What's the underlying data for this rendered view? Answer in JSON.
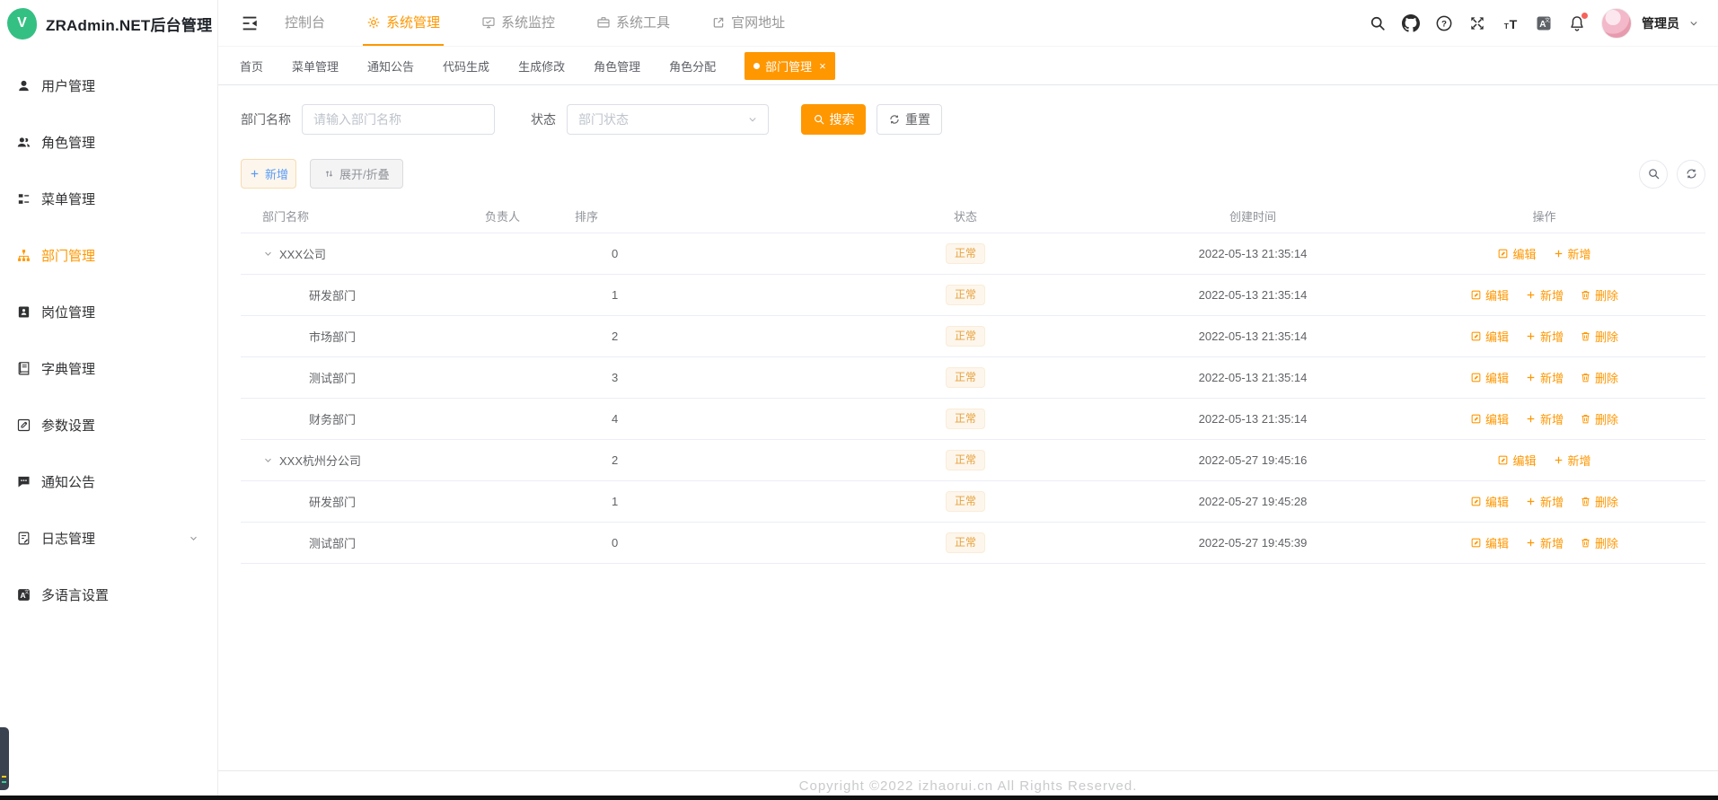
{
  "app": {
    "title": "ZRAdmin.NET后台管理",
    "logo_letter": "V",
    "accent_color": "#ff9700"
  },
  "sidebar": {
    "items": [
      {
        "label": "用户管理",
        "icon": "user-icon",
        "active": false
      },
      {
        "label": "角色管理",
        "icon": "users-icon",
        "active": false
      },
      {
        "label": "菜单管理",
        "icon": "menu-tree-icon",
        "active": false
      },
      {
        "label": "部门管理",
        "icon": "org-tree-icon",
        "active": true
      },
      {
        "label": "岗位管理",
        "icon": "id-badge-icon",
        "active": false
      },
      {
        "label": "字典管理",
        "icon": "dictionary-icon",
        "active": false
      },
      {
        "label": "参数设置",
        "icon": "pen-square-icon",
        "active": false
      },
      {
        "label": "通知公告",
        "icon": "comment-icon",
        "active": false
      },
      {
        "label": "日志管理",
        "icon": "log-icon",
        "active": false,
        "expandable": true
      },
      {
        "label": "多语言设置",
        "icon": "language-icon",
        "active": false
      }
    ]
  },
  "topnav": {
    "items": [
      {
        "label": "控制台",
        "icon": null,
        "active": false
      },
      {
        "label": "系统管理",
        "icon": "gear-icon",
        "active": true
      },
      {
        "label": "系统监控",
        "icon": "monitor-icon",
        "active": false
      },
      {
        "label": "系统工具",
        "icon": "toolbox-icon",
        "active": false
      },
      {
        "label": "官网地址",
        "icon": "external-link-icon",
        "active": false
      }
    ],
    "user": {
      "name": "管理员"
    }
  },
  "tabs": {
    "items": [
      {
        "label": "首页",
        "active": false
      },
      {
        "label": "菜单管理",
        "active": false
      },
      {
        "label": "通知公告",
        "active": false
      },
      {
        "label": "代码生成",
        "active": false
      },
      {
        "label": "生成修改",
        "active": false
      },
      {
        "label": "角色管理",
        "active": false
      },
      {
        "label": "角色分配",
        "active": false
      },
      {
        "label": "部门管理",
        "active": true,
        "closable": true
      }
    ]
  },
  "filter": {
    "name_label": "部门名称",
    "name_placeholder": "请输入部门名称",
    "status_label": "状态",
    "status_placeholder": "部门状态",
    "search_button": "搜索",
    "reset_button": "重置"
  },
  "toolbar": {
    "add_button": "新增",
    "expand_button": "展开/折叠"
  },
  "table": {
    "columns": [
      "部门名称",
      "负责人",
      "排序",
      "状态",
      "创建时间",
      "操作"
    ],
    "rows": [
      {
        "name": "XXX公司",
        "level": 0,
        "expanded": true,
        "leader": "",
        "order": "0",
        "status": "正常",
        "created": "2022-05-13 21:35:14",
        "actions": [
          "编辑",
          "新增"
        ]
      },
      {
        "name": "研发部门",
        "level": 1,
        "expanded": false,
        "leader": "",
        "order": "1",
        "status": "正常",
        "created": "2022-05-13 21:35:14",
        "actions": [
          "编辑",
          "新增",
          "删除"
        ]
      },
      {
        "name": "市场部门",
        "level": 1,
        "expanded": false,
        "leader": "",
        "order": "2",
        "status": "正常",
        "created": "2022-05-13 21:35:14",
        "actions": [
          "编辑",
          "新增",
          "删除"
        ]
      },
      {
        "name": "测试部门",
        "level": 1,
        "expanded": false,
        "leader": "",
        "order": "3",
        "status": "正常",
        "created": "2022-05-13 21:35:14",
        "actions": [
          "编辑",
          "新增",
          "删除"
        ]
      },
      {
        "name": "财务部门",
        "level": 1,
        "expanded": false,
        "leader": "",
        "order": "4",
        "status": "正常",
        "created": "2022-05-13 21:35:14",
        "actions": [
          "编辑",
          "新增",
          "删除"
        ]
      },
      {
        "name": "XXX杭州分公司",
        "level": 0,
        "expanded": true,
        "leader": "",
        "order": "2",
        "status": "正常",
        "created": "2022-05-27 19:45:16",
        "actions": [
          "编辑",
          "新增"
        ]
      },
      {
        "name": "研发部门",
        "level": 1,
        "expanded": false,
        "leader": "",
        "order": "1",
        "status": "正常",
        "created": "2022-05-27 19:45:28",
        "actions": [
          "编辑",
          "新增",
          "删除"
        ]
      },
      {
        "name": "测试部门",
        "level": 1,
        "expanded": false,
        "leader": "",
        "order": "0",
        "status": "正常",
        "created": "2022-05-27 19:45:39",
        "actions": [
          "编辑",
          "新增",
          "删除"
        ]
      }
    ]
  },
  "footer": {
    "copyright": "Copyright ©2022 izhaorui.cn All Rights Reserved."
  }
}
